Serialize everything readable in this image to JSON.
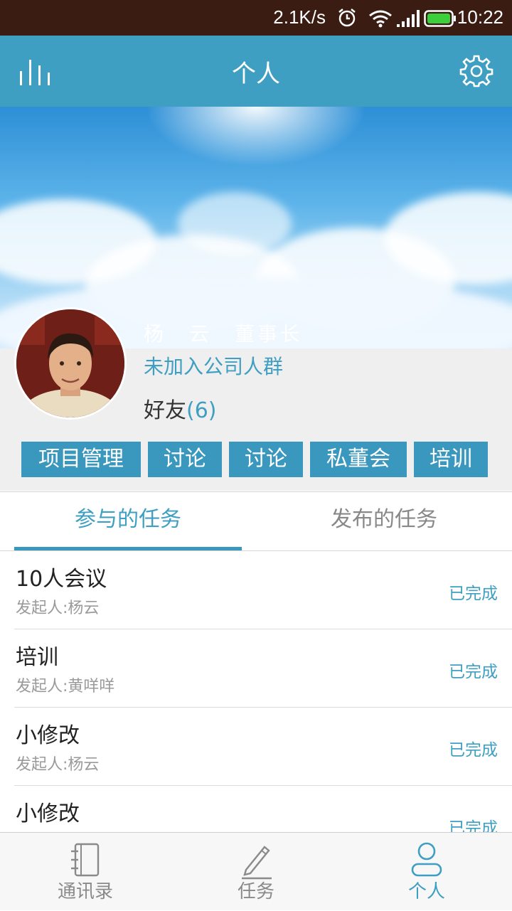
{
  "status_bar": {
    "net_speed": "2.1K/s",
    "time": "10:22"
  },
  "app_bar": {
    "title": "个人"
  },
  "profile": {
    "name": "杨　云　董事长",
    "group_status": "未加入公司人群",
    "friends_label": "好友",
    "friends_count": "(6)"
  },
  "tags": [
    "项目管理",
    "讨论",
    "讨论",
    "私董会",
    "培训"
  ],
  "tabs": [
    {
      "label": "参与的任务",
      "active": true
    },
    {
      "label": "发布的任务",
      "active": false
    }
  ],
  "tasks": [
    {
      "title": "10人会议",
      "starter": "发起人:杨云",
      "status": "已完成"
    },
    {
      "title": "培训",
      "starter": "发起人:黄咩咩",
      "status": "已完成"
    },
    {
      "title": "小修改",
      "starter": "发起人:杨云",
      "status": "已完成"
    },
    {
      "title": "小修改",
      "starter": "",
      "status": "已完成"
    }
  ],
  "bottom_nav": [
    {
      "label": "通讯录",
      "icon": "address-book-icon",
      "active": false
    },
    {
      "label": "任务",
      "icon": "pencil-icon",
      "active": false
    },
    {
      "label": "个人",
      "icon": "person-icon",
      "active": true
    }
  ],
  "colors": {
    "accent": "#3f9fc2",
    "tag_bg": "#3a97bd",
    "status_bar": "#3a1c12"
  }
}
